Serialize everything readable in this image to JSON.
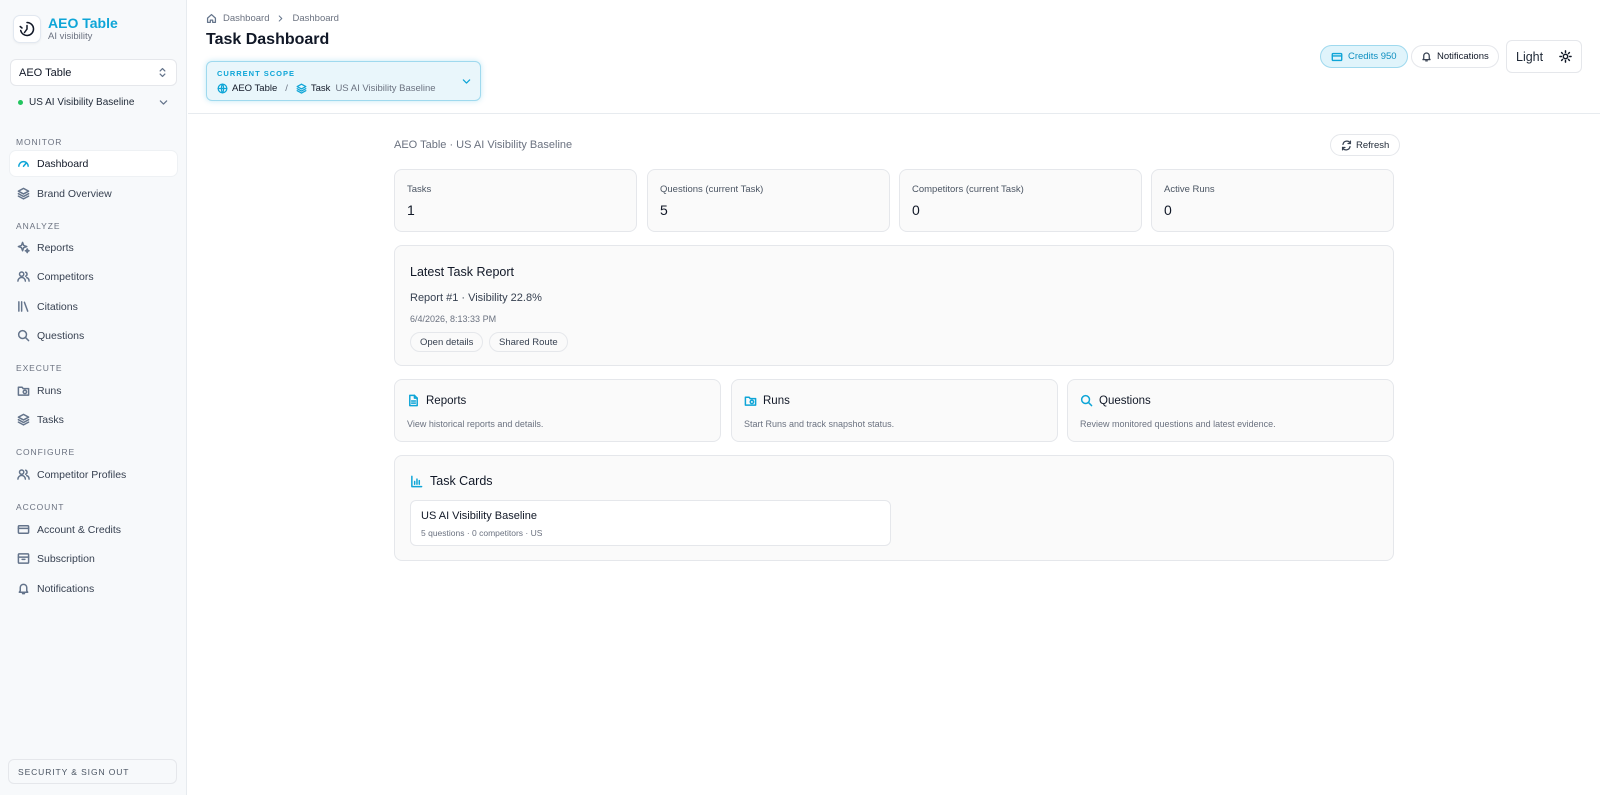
{
  "brand": {
    "name": "AEO Table",
    "tagline": "AI visibility"
  },
  "sidebar": {
    "project_select": "AEO Table",
    "task_select": "US AI Visibility Baseline",
    "sections": {
      "monitor": "MONITOR",
      "analyze": "ANALYZE",
      "execute": "EXECUTE",
      "configure": "CONFIGURE",
      "account": "ACCOUNT"
    },
    "items": {
      "dashboard": {
        "label": "Dashboard",
        "icon": "gauge-icon"
      },
      "brand_overview": {
        "label": "Brand Overview",
        "icon": "layers-icon"
      },
      "reports": {
        "label": "Reports",
        "icon": "sparkles-icon"
      },
      "competitors": {
        "label": "Competitors",
        "icon": "users-icon"
      },
      "citations": {
        "label": "Citations",
        "icon": "library-icon"
      },
      "questions": {
        "label": "Questions",
        "icon": "search-icon"
      },
      "runs": {
        "label": "Runs",
        "icon": "folder-clock-icon"
      },
      "tasks": {
        "label": "Tasks",
        "icon": "layers-icon"
      },
      "competitor_profiles": {
        "label": "Competitor Profiles",
        "icon": "users-icon"
      },
      "account_credits": {
        "label": "Account & Credits",
        "icon": "card-icon"
      },
      "subscription": {
        "label": "Subscription",
        "icon": "archive-icon"
      },
      "notifications": {
        "label": "Notifications",
        "icon": "bell-icon"
      }
    },
    "security": "SECURITY & SIGN OUT"
  },
  "header": {
    "breadcrumb": [
      "Dashboard",
      "Dashboard"
    ],
    "title": "Task Dashboard",
    "scope": {
      "label": "CURRENT SCOPE",
      "project": "AEO Table",
      "task_prefix": "Task",
      "task": "US AI Visibility Baseline"
    },
    "credits": "Credits 950",
    "notifications": "Notifications",
    "theme": "Light"
  },
  "main": {
    "context": "AEO Table · US AI Visibility Baseline",
    "refresh": "Refresh",
    "stats": [
      {
        "label": "Tasks",
        "value": "1"
      },
      {
        "label": "Questions (current Task)",
        "value": "5"
      },
      {
        "label": "Competitors (current Task)",
        "value": "0"
      },
      {
        "label": "Active Runs",
        "value": "0"
      }
    ],
    "latest": {
      "title": "Latest Task Report",
      "report": "Report #1 · Visibility 22.8%",
      "time": "6/4/2026, 8:13:33 PM",
      "open_details": "Open details",
      "shared_route": "Shared Route"
    },
    "links": [
      {
        "title": "Reports",
        "desc": "View historical reports and details."
      },
      {
        "title": "Runs",
        "desc": "Start Runs and track snapshot status."
      },
      {
        "title": "Questions",
        "desc": "Review monitored questions and latest evidence."
      }
    ],
    "task_cards": {
      "title": "Task Cards",
      "items": [
        {
          "name": "US AI Visibility Baseline",
          "meta": "5 questions · 0 competitors · US"
        }
      ]
    }
  },
  "colors": {
    "accent": "#0ea5d7",
    "status_active": "#22c55e"
  }
}
